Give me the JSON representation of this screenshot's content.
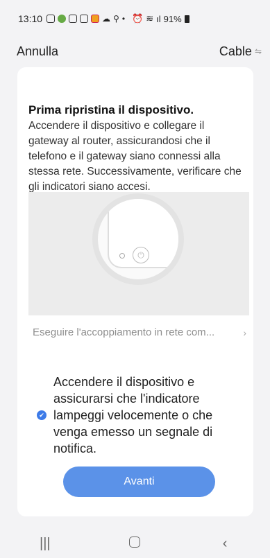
{
  "status": {
    "time": "13:10",
    "battery": "91%",
    "icons": [
      "instagram-icon",
      "app-icon",
      "instagram-icon",
      "instagram-icon",
      "app-icon",
      "cloud-icon",
      "location-icon",
      "dot-icon",
      "alarm-icon",
      "wifi-icon",
      "signal-icon",
      "battery-icon"
    ]
  },
  "header": {
    "cancel_label": "Annulla",
    "mode_label": "Cable",
    "mode_icon": "⇋"
  },
  "card": {
    "title": "Prima ripristina il dispositivo.",
    "description": "Accendere il dispositivo e collegare il gateway al router, assicurandosi che il telefono e il gateway siano connessi alla stessa rete. Successivamente, verificare che gli indicatori siano accesi.",
    "pair_link": "Eseguire l'accoppiamento in rete com...",
    "pair_link_chevron": "›",
    "confirm_text": "Accendere il dispositivo e assicurarsi che l'indicatore lampeggi velocemente o che venga emesso un segnale di notifica.",
    "confirm_checked": true,
    "next_button": "Avanti"
  },
  "navbar": {
    "recent_icon": "|||",
    "back_icon": "‹"
  },
  "colors": {
    "accent": "#5b92e8",
    "check": "#3d7be8",
    "background": "#f3f3f5",
    "card": "#ffffff"
  }
}
